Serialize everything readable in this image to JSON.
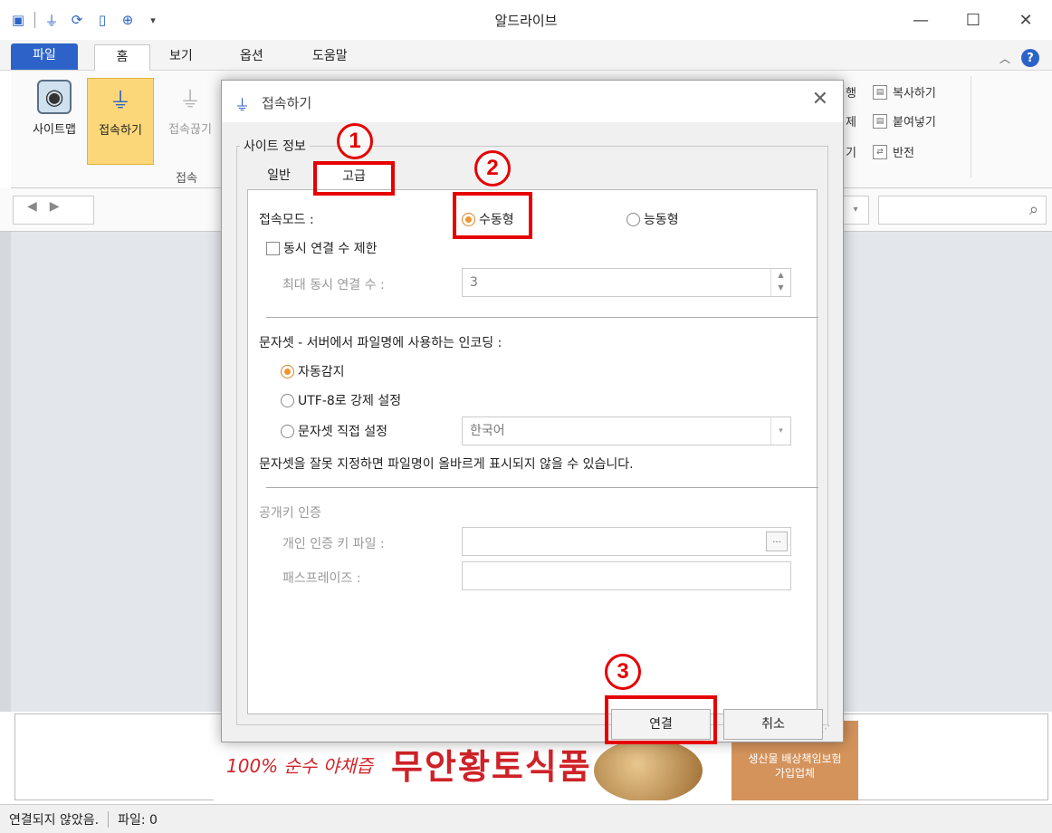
{
  "app": {
    "title": "알드라이브"
  },
  "ribbon_tabs": {
    "file": "파일",
    "home": "홈",
    "view": "보기",
    "options": "옵션",
    "help": "도움말"
  },
  "ribbon": {
    "sitemap": "사이트맵",
    "connect": "접속하기",
    "disconnect": "접속끊기",
    "group_connect": "접속",
    "run_partial": "행",
    "delete_partial": "제",
    "get_partial": "기",
    "copy": "복사하기",
    "paste": "붙여넣기",
    "invert": "반전"
  },
  "dialog": {
    "title": "접속하기",
    "group_label": "사이트 정보",
    "tab_general": "일반",
    "tab_advanced": "고급",
    "conn_mode_label": "접속모드 :",
    "passive": "수동형",
    "active": "능동형",
    "limit_label": "동시 연결 수 제한",
    "max_conn_label": "최대 동시 연결 수 :",
    "max_conn_value": "3",
    "charset_label": "문자셋 - 서버에서 파일명에 사용하는 인코딩 :",
    "auto_detect": "자동감지",
    "force_utf8": "UTF-8로 강제 설정",
    "manual_charset": "문자셋 직접 설정",
    "charset_value": "한국어",
    "charset_warning": "문자셋을 잘못 지정하면 파일명이 올바르게 표시되지 않을 수 있습니다.",
    "pubkey_label": "공개키 인증",
    "keyfile_label": "개인 인증 키 파일 :",
    "browse": "...",
    "passphrase_label": "패스프레이즈 :",
    "ok": "연결",
    "cancel": "취소"
  },
  "annotations": {
    "one": "1",
    "two": "2",
    "three": "3"
  },
  "ad": {
    "slogan": "100% 순수 야채즙",
    "brand": "무안황토식품",
    "badge_line1": "생산물 배상책임보험",
    "badge_line2": "가입업체"
  },
  "status": {
    "connection": "연결되지 않았음.",
    "files": "파일: 0"
  },
  "colors": {
    "accent": "#2d63c9",
    "highlight": "#fbd77a",
    "annotation": "#e60000"
  }
}
